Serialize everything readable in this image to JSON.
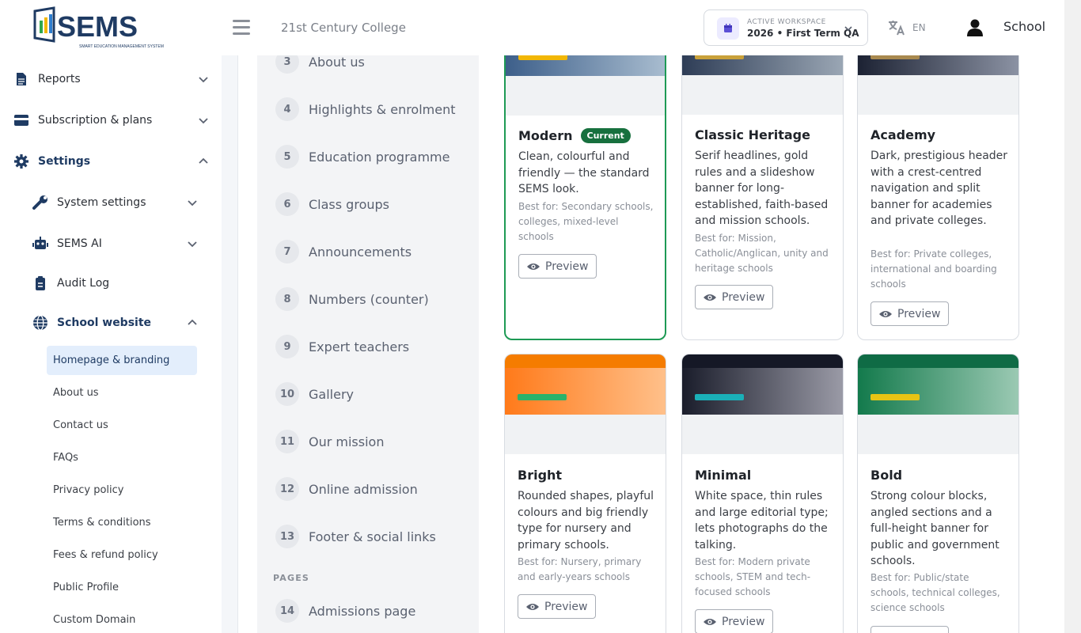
{
  "header": {
    "logo_text": "SEMS",
    "logo_tagline": "SMART EDUCATION MANAGEMENT SYSTEM",
    "college_name": "21st Century College",
    "workspace_label": "ACTIVE WORKSPACE",
    "workspace_value": "2026 • First Term QA",
    "language_code": "EN",
    "user_name": "School"
  },
  "sidebar": {
    "items": [
      {
        "label": "Reports"
      },
      {
        "label": "Subscription & plans"
      },
      {
        "label": "Settings"
      },
      {
        "label": "System settings"
      },
      {
        "label": "SEMS AI"
      },
      {
        "label": "Audit Log"
      },
      {
        "label": "School website"
      }
    ],
    "website_pages": [
      "Homepage & branding",
      "About us",
      "Contact us",
      "FAQs",
      "Privacy policy",
      "Terms & conditions",
      "Fees & refund policy",
      "Public Profile",
      "Custom Domain"
    ]
  },
  "steps": [
    {
      "num": "3",
      "label": "About us"
    },
    {
      "num": "4",
      "label": "Highlights & enrolment"
    },
    {
      "num": "5",
      "label": "Education programme"
    },
    {
      "num": "6",
      "label": "Class groups"
    },
    {
      "num": "7",
      "label": "Announcements"
    },
    {
      "num": "8",
      "label": "Numbers (counter)"
    },
    {
      "num": "9",
      "label": "Expert teachers"
    },
    {
      "num": "10",
      "label": "Gallery"
    },
    {
      "num": "11",
      "label": "Our mission"
    },
    {
      "num": "12",
      "label": "Online admission"
    },
    {
      "num": "13",
      "label": "Footer & social links"
    },
    {
      "num": "14",
      "label": "Admissions page"
    }
  ],
  "pages_section_label": "PAGES",
  "preview_label": "Preview",
  "current_badge": "Current",
  "themes": [
    {
      "name": "Modern",
      "description": "Clean, colourful and friendly — the standard SEMS look.",
      "best_for": "Best for: Secondary schools, colleges, mixed-level schools",
      "current": true
    },
    {
      "name": "Classic Heritage",
      "description": "Serif headlines, gold rules and a slideshow banner for long-established, faith-based and mission schools.",
      "best_for": "Best for: Mission, Catholic/Anglican, unity and heritage schools",
      "current": false
    },
    {
      "name": "Academy",
      "description": "Dark, prestigious header with a crest-centred navigation and split banner for academies and private colleges.",
      "best_for": "Best for: Private colleges, international and boarding schools",
      "current": false
    },
    {
      "name": "Bright",
      "description": "Rounded shapes, playful colours and big friendly type for nursery and primary schools.",
      "best_for": "Best for: Nursery, primary and early-years schools",
      "current": false
    },
    {
      "name": "Minimal",
      "description": "White space, thin rules and large editorial type; lets photographs do the talking.",
      "best_for": "Best for: Modern private schools, STEM and tech-focused schools",
      "current": false
    },
    {
      "name": "Bold",
      "description": "Strong colour blocks, angled sections and a full-height banner for public and government schools.",
      "best_for": "Best for: Public/state schools, technical colleges, science schools",
      "current": false
    }
  ],
  "colors": {
    "brand_blue": "#1f3b63",
    "current_green": "#1e9a55",
    "active_bg": "#e3eefc"
  }
}
